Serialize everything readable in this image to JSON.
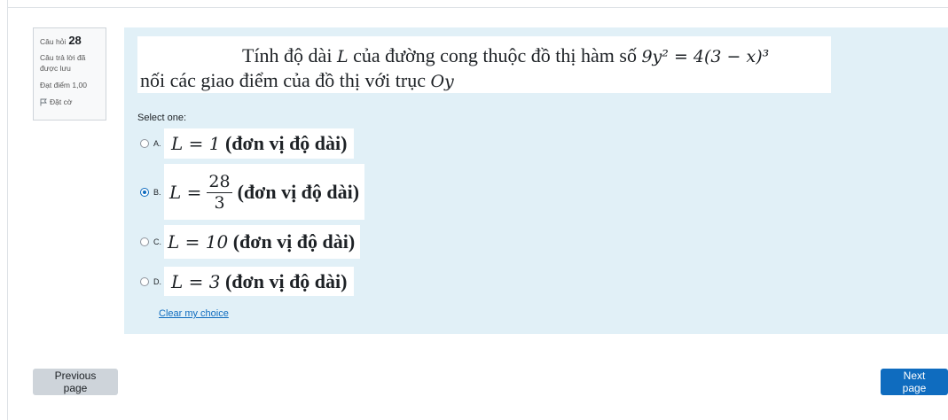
{
  "question_info": {
    "label": "Câu hỏi",
    "number": "28",
    "state": "Câu trả lời đã được lưu",
    "grade": "Đạt điểm 1,00",
    "flag_label": "Đặt cờ"
  },
  "question": {
    "text1_prefix": "Tính độ dài ",
    "text1_var": "L",
    "text1_mid": " của đường cong thuộc đồ thị hàm số ",
    "text1_eq": "9y² = 4(3 − x)³",
    "text2_prefix": "nối các giao điểm của đồ thị với trục ",
    "text2_axis": "Oy"
  },
  "select_label": "Select one:",
  "options": [
    {
      "letter": "A.",
      "math": "L = 1",
      "unit": "(đơn vị độ dài)",
      "selected": false
    },
    {
      "letter": "B.",
      "lhs": "L =",
      "num": "28",
      "den": "3",
      "unit": "(đơn vị độ dài)",
      "selected": true
    },
    {
      "letter": "C.",
      "math": "L = 10",
      "unit": "(đơn vị độ dài)",
      "selected": false
    },
    {
      "letter": "D.",
      "math": "L = 3",
      "unit": "(đơn vị độ dài)",
      "selected": false
    }
  ],
  "clear_label": "Clear my choice",
  "nav": {
    "prev_label": "Previous page",
    "next_label": "Next page"
  },
  "colors": {
    "accent": "#0f6cbf",
    "content_bg": "#e1f0f7"
  }
}
